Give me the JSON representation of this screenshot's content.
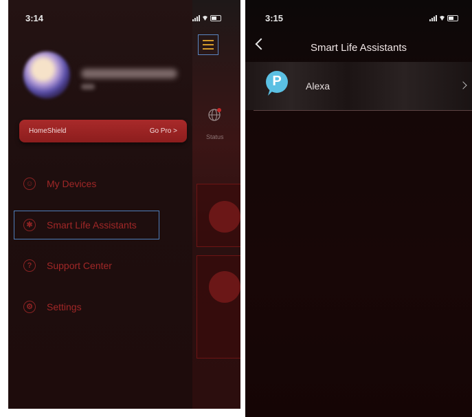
{
  "left_screen": {
    "status_time": "3:14",
    "homeshield": {
      "label": "HomeShield",
      "cta": "Go Pro >"
    },
    "menu": [
      {
        "label": "My Devices",
        "icon": "devices-icon"
      },
      {
        "label": "Smart Life Assistants",
        "icon": "assistants-icon",
        "selected": true
      },
      {
        "label": "Support Center",
        "icon": "help-icon"
      },
      {
        "label": "Settings",
        "icon": "gear-icon"
      }
    ],
    "underlay": {
      "status_label": "Status"
    }
  },
  "right_screen": {
    "status_time": "3:15",
    "title": "Smart Life Assistants",
    "items": [
      {
        "label": "Alexa",
        "icon": "alexa-icon"
      }
    ]
  },
  "colors": {
    "accent_red": "#a92a2a",
    "menu_text": "#a02727",
    "highlight_outline": "#4f7fbc",
    "alexa_blue": "#5bc0e3"
  }
}
